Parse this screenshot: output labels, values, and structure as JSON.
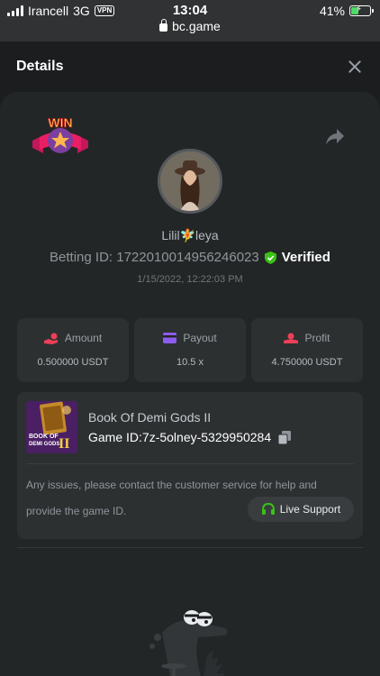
{
  "status_bar": {
    "carrier": "Irancell",
    "network": "3G",
    "vpn": "VPN",
    "time": "13:04",
    "url": "bc.game",
    "battery": "41%"
  },
  "header": {
    "title": "Details"
  },
  "icons": {
    "close": "close-icon",
    "share": "share-arrow-icon",
    "verified": "shield-check-icon",
    "copy": "copy-icon",
    "headset": "headset-icon"
  },
  "bet": {
    "username": "Lilil🧚leya",
    "betting_id": "Betting ID: 1722010014956246023",
    "verified_label": "Verified",
    "timestamp": "1/15/2022, 12:22:03 PM",
    "badge_text": "WIN"
  },
  "stats": [
    {
      "label": "Amount",
      "value": "0.500000 USDT",
      "icon": "hand-coin-icon"
    },
    {
      "label": "Payout",
      "value": "10.5 x",
      "icon": "card-icon"
    },
    {
      "label": "Profit",
      "value": "4.750000 USDT",
      "icon": "profit-hand-icon"
    }
  ],
  "game": {
    "name": "Book Of Demi Gods II",
    "game_id": "Game ID:7z-5olney-5329950284",
    "thumb_line1": "BOOK OF",
    "thumb_line2": "DEMI GODS",
    "thumb_roman": "II",
    "help_line1": "Any issues, please contact the customer service for help and",
    "help_line2": "provide the game ID.",
    "support_label": "Live Support"
  },
  "colors": {
    "background": "#1b1d1f",
    "panel": "#232626",
    "card": "#2d3031",
    "accent_green": "#3bc117",
    "accent_red": "#ed4058",
    "accent_purple": "#8c5cf0"
  }
}
